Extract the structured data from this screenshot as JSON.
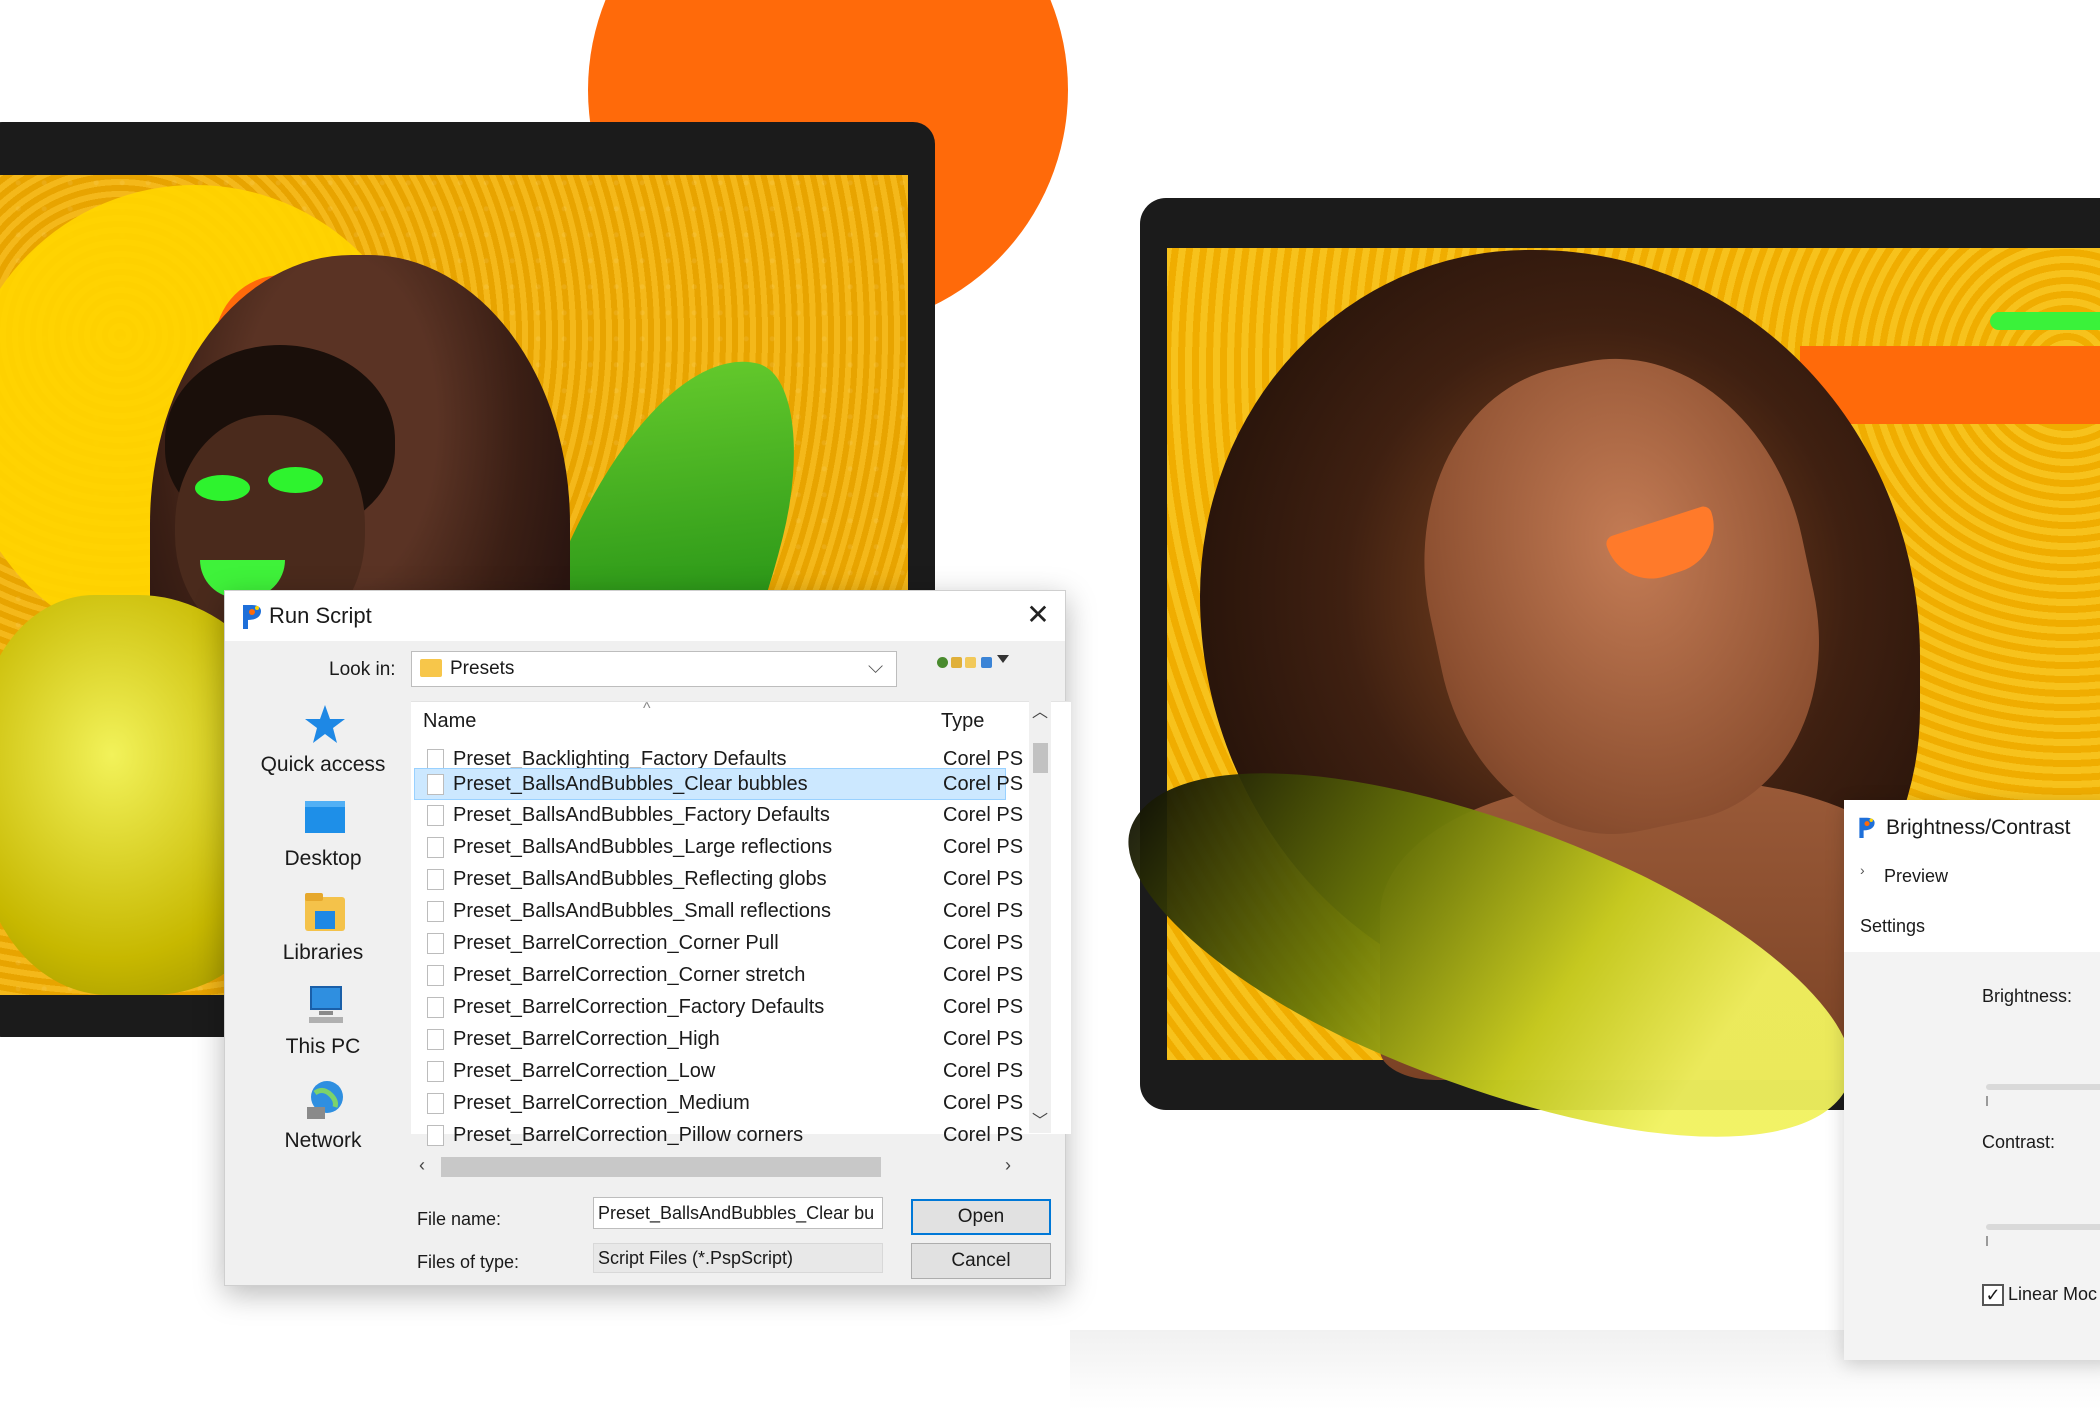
{
  "colors": {
    "accent_orange": "#ff6a0a",
    "accent_green": "#3af23a",
    "screen_yellow": "#f4b81a",
    "selection_bg": "#cce8ff",
    "default_button_border": "#0078d7"
  },
  "run_script_dialog": {
    "title": "Run Script",
    "app_icon": "paintshop-icon",
    "close_icon": "close-icon",
    "close_glyph": "✕",
    "look_in_label": "Look in:",
    "look_in_value": "Presets",
    "places": [
      {
        "label": "Quick access",
        "icon": "star-icon"
      },
      {
        "label": "Desktop",
        "icon": "desktop-icon"
      },
      {
        "label": "Libraries",
        "icon": "libraries-icon"
      },
      {
        "label": "This PC",
        "icon": "computer-icon"
      },
      {
        "label": "Network",
        "icon": "network-icon"
      }
    ],
    "columns": {
      "name": "Name",
      "type": "Type"
    },
    "files": [
      {
        "name": "Preset_Backlighting_Factory Defaults",
        "type": "Corel PS",
        "selected": false
      },
      {
        "name": "Preset_BallsAndBubbles_Clear bubbles",
        "type": "Corel PS",
        "selected": true
      },
      {
        "name": "Preset_BallsAndBubbles_Factory Defaults",
        "type": "Corel PS",
        "selected": false
      },
      {
        "name": "Preset_BallsAndBubbles_Large reflections",
        "type": "Corel PS",
        "selected": false
      },
      {
        "name": "Preset_BallsAndBubbles_Reflecting globs",
        "type": "Corel PS",
        "selected": false
      },
      {
        "name": "Preset_BallsAndBubbles_Small reflections",
        "type": "Corel PS",
        "selected": false
      },
      {
        "name": "Preset_BarrelCorrection_Corner Pull",
        "type": "Corel PS",
        "selected": false
      },
      {
        "name": "Preset_BarrelCorrection_Corner stretch",
        "type": "Corel PS",
        "selected": false
      },
      {
        "name": "Preset_BarrelCorrection_Factory Defaults",
        "type": "Corel PS",
        "selected": false
      },
      {
        "name": "Preset_BarrelCorrection_High",
        "type": "Corel PS",
        "selected": false
      },
      {
        "name": "Preset_BarrelCorrection_Low",
        "type": "Corel PS",
        "selected": false
      },
      {
        "name": "Preset_BarrelCorrection_Medium",
        "type": "Corel PS",
        "selected": false
      },
      {
        "name": "Preset_BarrelCorrection_Pillow corners",
        "type": "Corel PS",
        "selected": false
      }
    ],
    "file_name_label": "File name:",
    "file_name_value": "Preset_BallsAndBubbles_Clear bu",
    "files_of_type_label": "Files of type:",
    "files_of_type_value": "Script Files (*.PspScript)",
    "open_label": "Open",
    "cancel_label": "Cancel"
  },
  "brightness_contrast_dialog": {
    "title": "Brightness/Contrast",
    "preview_label": "Preview",
    "settings_label": "Settings",
    "brightness_label": "Brightness:",
    "contrast_label": "Contrast:",
    "linear_label": "Linear Moc",
    "linear_checked": true
  }
}
